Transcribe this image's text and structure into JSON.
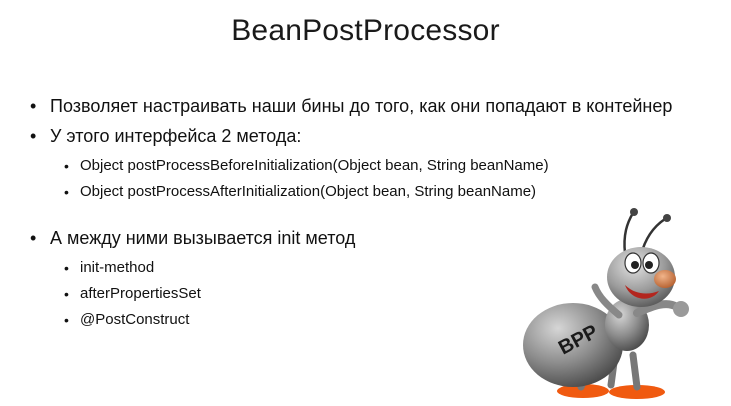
{
  "slide": {
    "title": "BeanPostProcessor",
    "bullets": [
      {
        "text": "Позволяет настраивать наши бины до того, как они попадают в контейнер"
      },
      {
        "text": "У этого интерфейса 2 метода:",
        "sub": [
          "Object postProcessBeforeInitialization(Object bean, String beanName)",
          "Object postProcessAfterInitialization(Object bean, String beanName)"
        ]
      },
      {
        "text": "А между ними вызывается init метод",
        "sub": [
          "init-method",
          "afterPropertiesSet",
          "@PostConstruct"
        ]
      }
    ],
    "mascot": {
      "label": "BPP",
      "icon": "ant-mascot-icon"
    }
  },
  "colors": {
    "text": "#111111",
    "ant_body": "#8a8a8a",
    "ant_nose": "#c9764a",
    "ant_shoes": "#f05a10"
  }
}
